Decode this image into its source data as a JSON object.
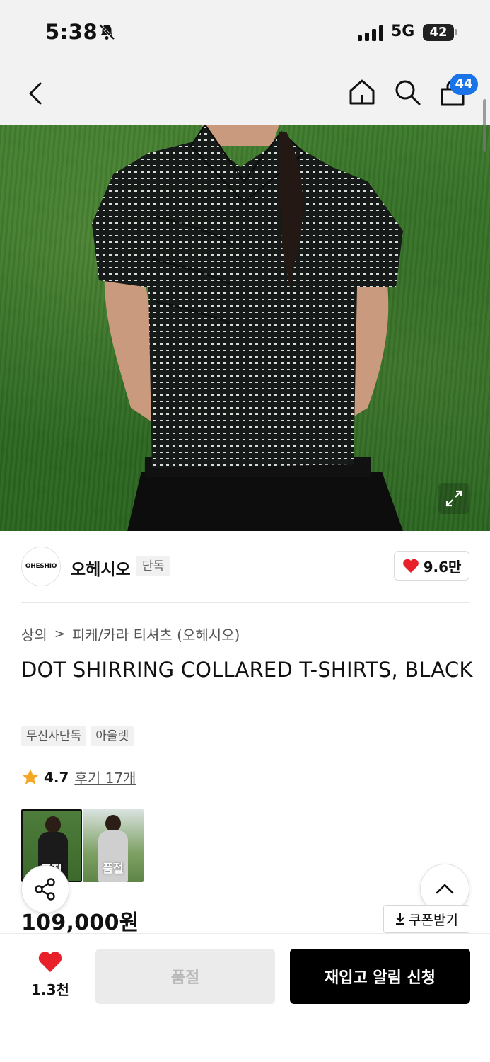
{
  "status_bar": {
    "time": "5:38",
    "network": "5G",
    "battery": "42",
    "battery_level_percent": 42
  },
  "nav": {
    "cart_badge": "44"
  },
  "brand": {
    "logo_text": "OHESHIO",
    "name": "오헤시오",
    "tag": "단독",
    "likes": "9.6만"
  },
  "product": {
    "breadcrumb": [
      "상의",
      "피케/카라 티셔츠 (오헤시오)"
    ],
    "title": "DOT SHIRRING COLLARED T-SHIRTS, BLACK",
    "tags": [
      "무신사단독",
      "아울렛"
    ],
    "rating": "4.7",
    "reviews": "후기 17개",
    "price": "109,000원",
    "colors": [
      {
        "name": "black",
        "status": "품절"
      },
      {
        "name": "gray",
        "status": "품절"
      }
    ]
  },
  "actions": {
    "coupon": "쿠폰받기",
    "wish_count": "1.3천",
    "soldout": "품절",
    "restock": "재입고 알림 신청"
  },
  "colors": {
    "heart": "#e8202a",
    "badge": "#1a73e8",
    "rating_star": "#f5a623"
  }
}
